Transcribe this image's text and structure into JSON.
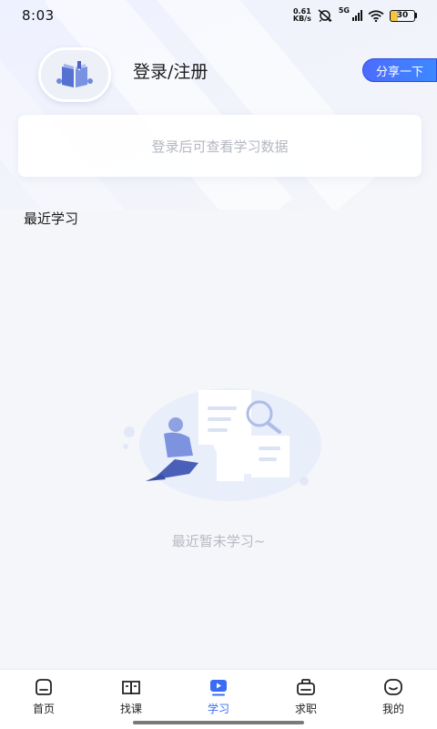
{
  "status_bar": {
    "time": "8:03",
    "net_speed_value": "0.61",
    "net_speed_unit": "KB/s",
    "network_gen": "5G",
    "battery": "30"
  },
  "profile": {
    "login_label": "登录/注册",
    "share_label": "分享一下"
  },
  "data_card": {
    "message": "登录后可查看学习数据"
  },
  "recent": {
    "section_title": "最近学习",
    "empty_message": "最近暂未学习~"
  },
  "tabbar": {
    "items": [
      {
        "label": "首页",
        "icon": "home-icon"
      },
      {
        "label": "找课",
        "icon": "book-icon"
      },
      {
        "label": "学习",
        "icon": "play-icon",
        "active": true
      },
      {
        "label": "求职",
        "icon": "briefcase-icon"
      },
      {
        "label": "我的",
        "icon": "smile-icon"
      }
    ]
  },
  "colors": {
    "accent": "#3a6cf5",
    "share_gradient_start": "#4d6bff",
    "share_gradient_end": "#3d88ff",
    "background": "#f5f6fa"
  }
}
